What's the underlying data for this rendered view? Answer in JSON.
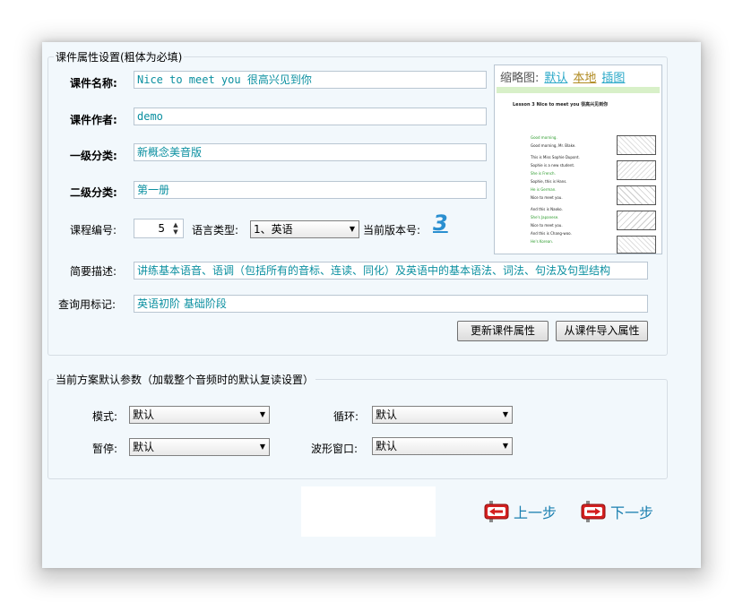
{
  "properties": {
    "legend": "课件属性设置(粗体为必填)",
    "name_label": "课件名称:",
    "name_value": "Nice to meet you 很高兴见到你",
    "author_label": "课件作者:",
    "author_value": "demo",
    "category1_label": "一级分类:",
    "category1_value": "新概念美音版",
    "category2_label": "二级分类:",
    "category2_value": "第一册",
    "course_no_label": "课程编号:",
    "course_no_value": "5",
    "language_label": "语言类型:",
    "language_value": "1、英语",
    "version_label": "当前版本号:",
    "version_value": "3",
    "summary_label": "简要描述:",
    "summary_value": "讲练基本语音、语调（包括所有的音标、连读、同化）及英语中的基本语法、词法、句法及句型结构",
    "tags_label": "查询用标记:",
    "tags_value": "英语初阶 基础阶段",
    "update_button": "更新课件属性",
    "import_button": "从课件导入属性"
  },
  "thumbnail": {
    "label": "缩略图:",
    "link_default": "默认",
    "link_local": "本地",
    "link_insert": "插图",
    "page_title": "Lesson 3  Nice to meet you  很高兴见到你",
    "page_lines": [
      "Good morning.",
      "Good morning, Mr. Blake.",
      "This is Miss Sophie Dupont.",
      "Sophie is a new student.",
      "She is French.",
      "Sophie, this is Hans.",
      "He is German.",
      "Nice to meet you.",
      "And this is Naoko.",
      "She's Japanese.",
      "Nice to meet you.",
      "And this is Chang-woo.",
      "He's Korean."
    ]
  },
  "defaults": {
    "legend": "当前方案默认参数（加载整个音频时的默认复读设置）",
    "mode_label": "模式:",
    "mode_value": "默认",
    "loop_label": "循环:",
    "loop_value": "默认",
    "pause_label": "暂停:",
    "pause_value": "默认",
    "wave_label": "波形窗口:",
    "wave_value": "默认"
  },
  "nav": {
    "prev": "上一步",
    "next": "下一步"
  },
  "colors": {
    "window_bg": "#f2f8fc",
    "field_text": "#0a8fa0",
    "nav_text": "#1a7fb0",
    "nav_icon": "#d42020",
    "version_digit": "#2a8fd0"
  }
}
